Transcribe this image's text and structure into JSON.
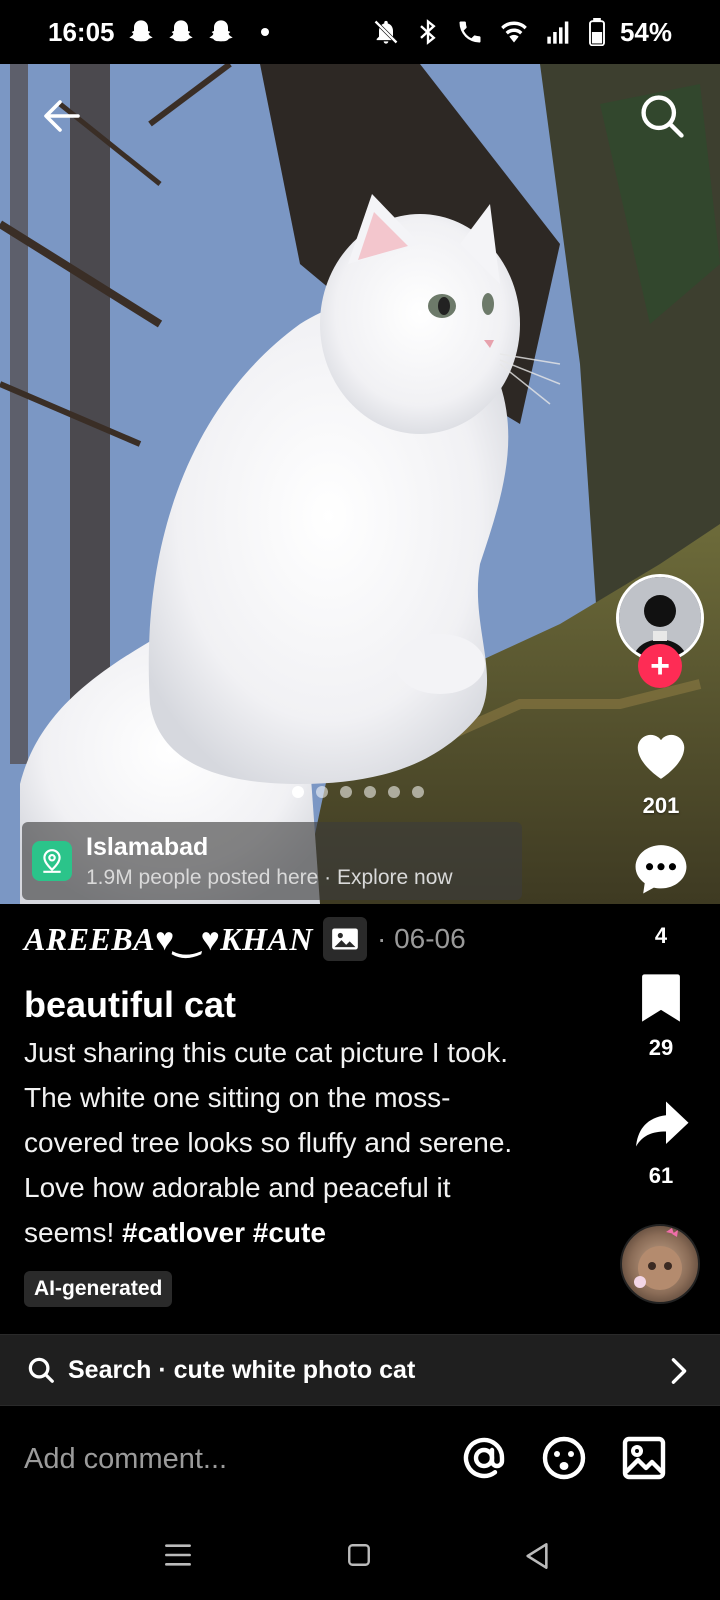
{
  "status_bar": {
    "time": "16:05",
    "battery": "54%"
  },
  "post": {
    "carousel": {
      "count": 6,
      "active_index": 0
    },
    "location": {
      "name": "Islamabad",
      "subtitle": "1.9M people posted here · Explore now"
    },
    "author": "AREEBA♥‿♥KHAN",
    "date": "· 06-06",
    "title": "beautiful cat",
    "body": "Just sharing this cute cat picture I took. The white one sitting on the moss-covered tree looks so fluffy and serene. Love how adorable and peaceful it seems!",
    "hashtags": "#catlover #cute",
    "ai_label": "AI-generated"
  },
  "actions": {
    "likes": "201",
    "comments": "4",
    "saves": "29",
    "shares": "61",
    "follow_symbol": "+"
  },
  "search_suggestion": {
    "label": "Search · cute white photo cat"
  },
  "comment_bar": {
    "placeholder": "Add comment..."
  },
  "colors": {
    "accent": "#fe2c55",
    "location_icon": "#2bc48a",
    "background": "#000000"
  }
}
